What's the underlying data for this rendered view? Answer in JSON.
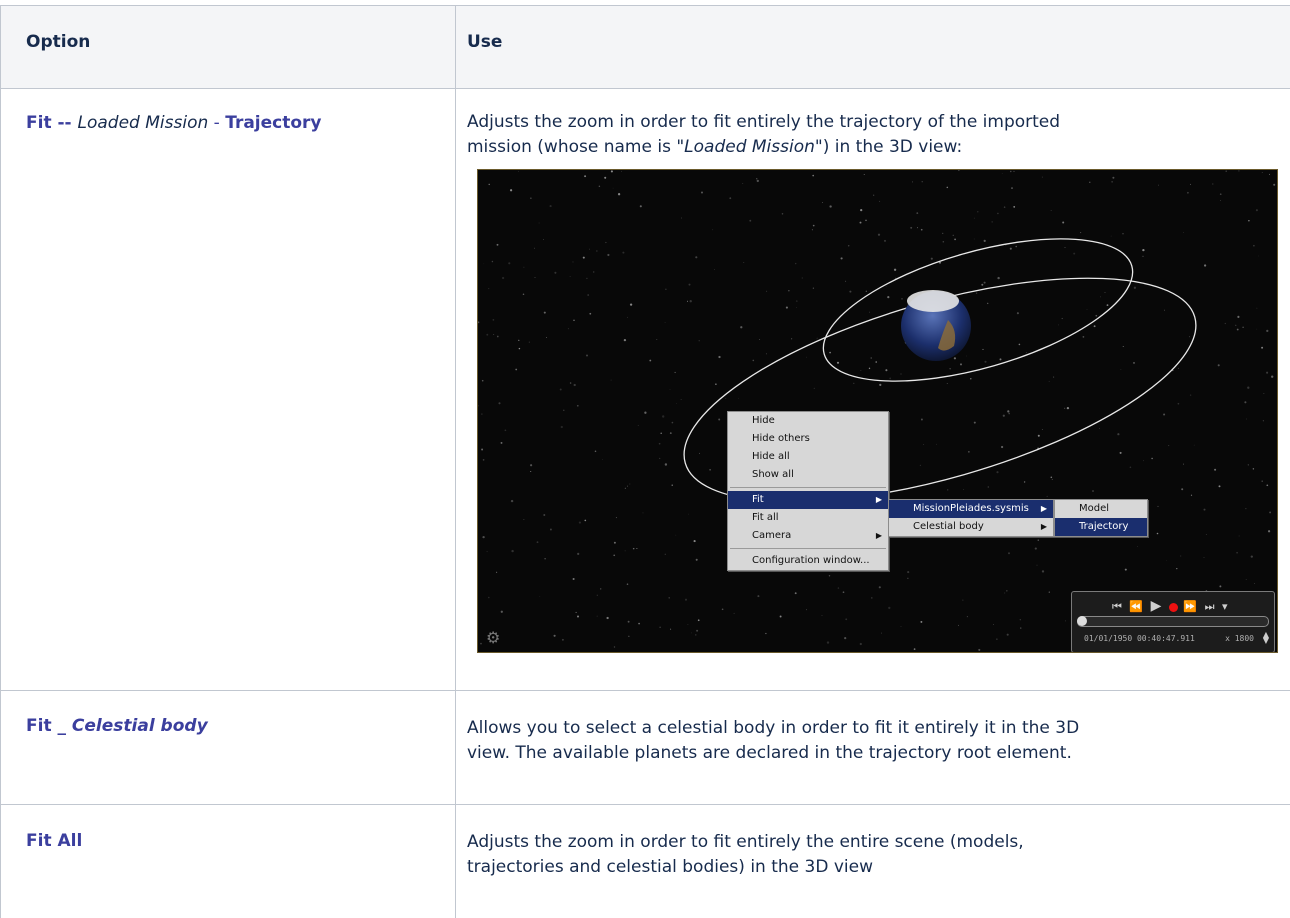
{
  "header": {
    "option": "Option",
    "use": "Use"
  },
  "rows": [
    {
      "option": {
        "part1": "Fit -- ",
        "part2": "Loaded Mission",
        "part3": " - ",
        "part4": "Trajectory"
      },
      "use": {
        "line1": "Adjusts the zoom in order to fit entirely the trajectory of the imported",
        "line2a": "mission (whose name is \"",
        "line2b": "Loaded Mission",
        "line2c": "\") in the 3D view:"
      }
    },
    {
      "option": {
        "part1": "Fit _ ",
        "part2": "Celestial body"
      },
      "use": {
        "line1": "Allows you to select a celestial body in order to fit it entirely it in the 3D",
        "line2": "view. The available planets are declared in the trajectory root element."
      }
    },
    {
      "option": {
        "part1": "Fit All"
      },
      "use": {
        "line1": "Adjusts the zoom in order to fit entirely the entire scene (models,",
        "line2": "trajectories and celestial bodies) in the 3D view"
      }
    }
  ],
  "context_menu": {
    "items": [
      "Hide",
      "Hide others",
      "Hide all",
      "Show all",
      "Fit",
      "Fit all",
      "Camera",
      "Configuration window..."
    ],
    "submenu1": [
      "MissionPleiades.sysmis",
      "Celestial body"
    ],
    "submenu2": [
      "Model",
      "Trajectory"
    ]
  },
  "player": {
    "time": "01/01/1950 00:40:47.911",
    "speed": "x 1800"
  },
  "colors": {
    "link": "#3b3f9e",
    "text": "#172b4d",
    "header_bg": "#f4f5f7",
    "menu_selected": "#1a2e6e"
  }
}
